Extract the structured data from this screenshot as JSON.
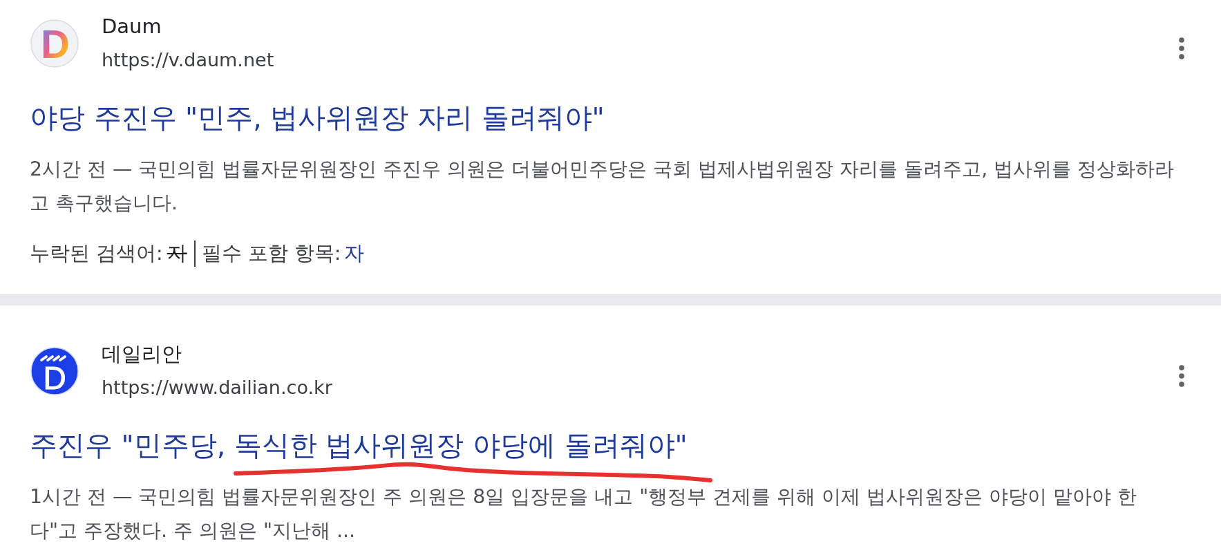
{
  "results": [
    {
      "site": {
        "name": "Daum",
        "url": "https://v.daum.net",
        "logo": {
          "kind": "gradient",
          "letter": "D"
        }
      },
      "title": "야당 주진우 \"민주, 법사위원장 자리 돌려줘야\"",
      "snippet": "2시간 전 — 국민의힘 법률자문위원장인 주진우 의원은 더불어민주당은 국회 법제사법위원장 자리를 돌려주고, 법사위를 정상화하라고 촉구했습니다.",
      "underlined": false,
      "term_notice": {
        "missing_label": "누락된 검색어:",
        "missing_term": "자",
        "missing_struck": true,
        "required_label": "필수 포함 항목:",
        "required_term": "자"
      }
    },
    {
      "site": {
        "name": "데일리안",
        "url": "https://www.dailian.co.kr",
        "logo": {
          "kind": "badge",
          "letter": "D"
        }
      },
      "title": "주진우 \"민주당, 독식한 법사위원장 야당에 돌려줘야\"",
      "snippet": "1시간 전 — 국민의힘 법률자문위원장인 주 의원은 8일 입장문을 내고 \"행정부 견제를 위해 이제 법사위원장은 야당이 맡아야 한다\"고 주장했다. 주 의원은 \"지난해 ...",
      "underlined": true
    }
  ]
}
